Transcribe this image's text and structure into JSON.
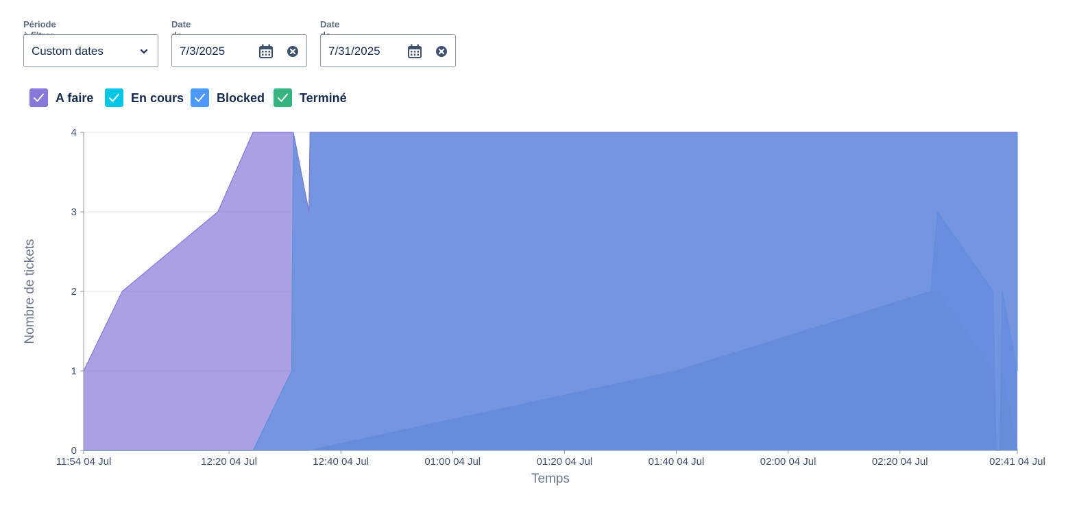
{
  "filters": {
    "period": {
      "label": "Période à filtrer",
      "value": "Custom dates"
    },
    "start": {
      "label": "Date de début",
      "value": "7/3/2025"
    },
    "end": {
      "label": "Date de fin",
      "value": "7/31/2025"
    }
  },
  "legend": [
    {
      "label": "A faire",
      "color": "#8777d9",
      "checked": true
    },
    {
      "label": "En cours",
      "color": "#00c7e6",
      "checked": true
    },
    {
      "label": "Blocked",
      "color": "#4c9aff",
      "checked": true
    },
    {
      "label": "Terminé",
      "color": "#36b37e",
      "checked": true
    }
  ],
  "chart_data": {
    "type": "area",
    "stacked": true,
    "xlabel": "Temps",
    "ylabel": "Nombre de tickets",
    "ylim": [
      0,
      4
    ],
    "yticks": [
      0,
      1,
      2,
      3,
      4
    ],
    "xlim_minutes": [
      0,
      167
    ],
    "x_ticks": [
      {
        "t": 0,
        "label": "11:54 04 Jul"
      },
      {
        "t": 26,
        "label": "12:20 04 Jul"
      },
      {
        "t": 46,
        "label": "12:40 04 Jul"
      },
      {
        "t": 66,
        "label": "01:00 04 Jul"
      },
      {
        "t": 86,
        "label": "01:20 04 Jul"
      },
      {
        "t": 106,
        "label": "01:40 04 Jul"
      },
      {
        "t": 126,
        "label": "02:00 04 Jul"
      },
      {
        "t": 146,
        "label": "02:20 04 Jul"
      },
      {
        "t": 167,
        "label": "02:41 04 Jul"
      }
    ],
    "grid": true,
    "series": [
      {
        "name": "Terminé",
        "color": "#36b37e",
        "points": [
          [
            0,
            0
          ],
          [
            40.3,
            0
          ],
          [
            106,
            1
          ],
          [
            151.5,
            2
          ],
          [
            152.7,
            2
          ],
          [
            162.7,
            1
          ],
          [
            163.2,
            0
          ],
          [
            163.9,
            0
          ],
          [
            164.3,
            1
          ],
          [
            167,
            0
          ]
        ]
      },
      {
        "name": "Blocked",
        "color": "#4c9aff",
        "points": [
          [
            0,
            0
          ],
          [
            40.3,
            0
          ],
          [
            106,
            1
          ],
          [
            151.5,
            2
          ],
          [
            152.7,
            3
          ],
          [
            162.7,
            2
          ],
          [
            163.2,
            0
          ],
          [
            163.9,
            0
          ],
          [
            164.3,
            2
          ],
          [
            167,
            1
          ],
          [
            167,
            4
          ]
        ]
      },
      {
        "name": "En cours",
        "color": "#00c7e6",
        "points": [
          [
            0,
            0
          ],
          [
            30.3,
            0
          ],
          [
            37.2,
            1
          ],
          [
            37.5,
            4
          ],
          [
            40.3,
            3
          ],
          [
            40.5,
            4
          ],
          [
            167,
            4
          ]
        ]
      },
      {
        "name": "A faire",
        "color": "#8777d9",
        "points": [
          [
            0,
            1
          ],
          [
            6.9,
            2
          ],
          [
            24,
            3
          ],
          [
            30.3,
            4
          ],
          [
            37.5,
            4
          ],
          [
            40.3,
            3
          ],
          [
            40.5,
            4
          ],
          [
            167,
            4
          ]
        ]
      }
    ]
  }
}
